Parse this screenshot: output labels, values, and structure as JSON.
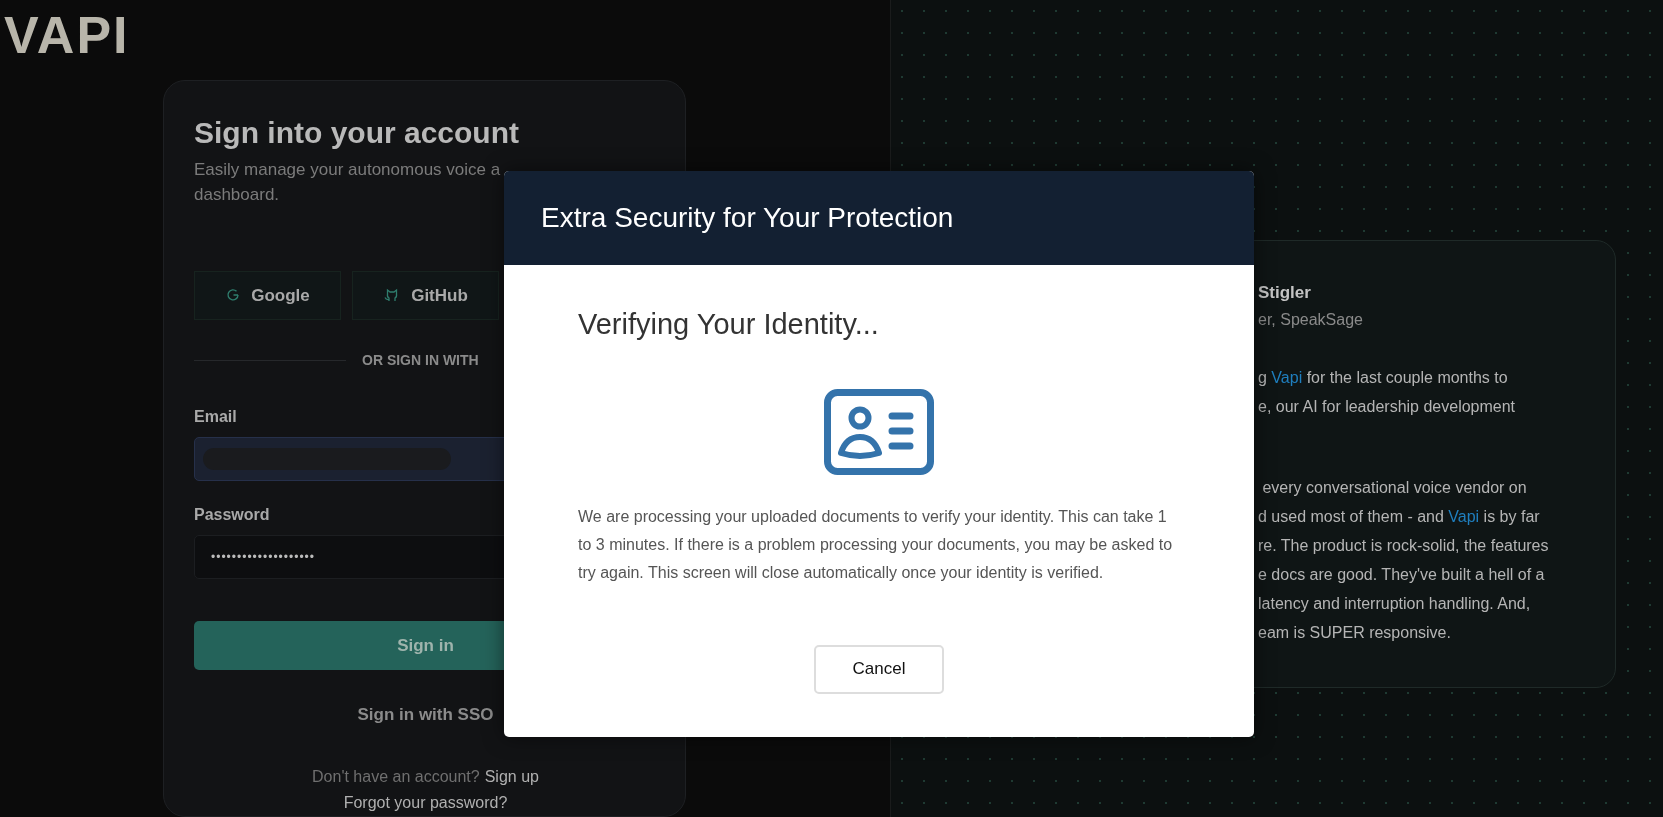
{
  "logo": "VAPI",
  "signin": {
    "title": "Sign into your account",
    "subtitle_lines": [
      "Easily manage your autonomous voice a",
      "dashboard."
    ],
    "providers": [
      {
        "label": "Google",
        "kind": "google"
      },
      {
        "label": "GitHub",
        "kind": "github"
      }
    ],
    "divider": "OR SIGN IN WITH",
    "email": {
      "label": "Email"
    },
    "password": {
      "label": "Password",
      "value": "••••••••••••••••••••"
    },
    "submit": "Sign in",
    "sso": "Sign in with SSO",
    "signup_prompt": "Don't have an account?",
    "signup_link": "Sign up",
    "forgot": "Forgot your password?"
  },
  "testimonial": {
    "name": "Stigler",
    "role": "er, SpeakSage",
    "paragraphs": [
      [
        [
          {
            "text": "g ",
            "kind": "plain"
          },
          {
            "text": "Vapi",
            "kind": "link"
          },
          {
            "text": " for the last couple months to",
            "kind": "plain"
          }
        ],
        [
          {
            "text": "e, our AI for leadership development",
            "kind": "plain"
          }
        ]
      ],
      [
        [
          {
            "text": " every conversational voice vendor on",
            "kind": "plain"
          }
        ],
        [
          {
            "text": "d used most of them - and ",
            "kind": "plain"
          },
          {
            "text": "Vapi",
            "kind": "link"
          },
          {
            "text": " is by far",
            "kind": "plain"
          }
        ],
        [
          {
            "text": "re. The product is rock-solid, the features",
            "kind": "plain"
          }
        ],
        [
          {
            "text": "e docs are good. They've built a hell of a",
            "kind": "plain"
          }
        ],
        [
          {
            "text": "latency and interruption handling. And,",
            "kind": "plain"
          }
        ],
        [
          {
            "text": "eam is SUPER responsive.",
            "kind": "plain"
          }
        ]
      ]
    ]
  },
  "dialog": {
    "title": "Extra Security for Your Protection",
    "heading": "Verifying Your Identity...",
    "message": "We are processing your uploaded documents to verify your identity. This can take 1 to 3 minutes. If there is a problem processing your documents, you may be asked to try again. This screen will close automatically once your identity is verified.",
    "buttons": [
      "Cancel"
    ]
  }
}
